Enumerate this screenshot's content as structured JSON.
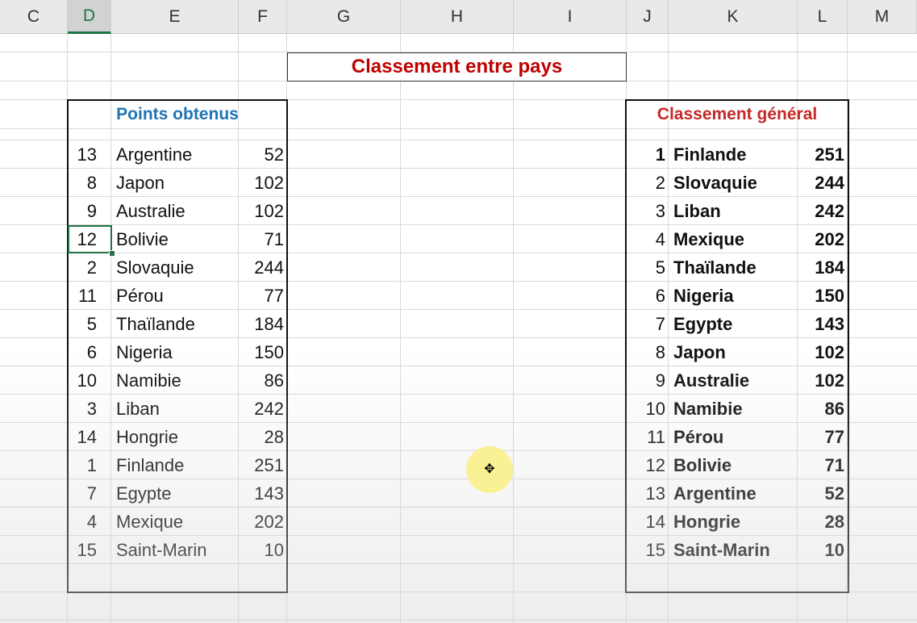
{
  "columns": [
    "C",
    "D",
    "E",
    "F",
    "G",
    "H",
    "I",
    "J",
    "K",
    "L",
    "M"
  ],
  "active_column": "D",
  "title": "Classement entre pays",
  "left_table": {
    "header": "Points obtenus",
    "rows": [
      {
        "rank": "13",
        "country": "Argentine",
        "points": "52"
      },
      {
        "rank": "8",
        "country": "Japon",
        "points": "102"
      },
      {
        "rank": "9",
        "country": "Australie",
        "points": "102"
      },
      {
        "rank": "12",
        "country": "Bolivie",
        "points": "71"
      },
      {
        "rank": "2",
        "country": "Slovaquie",
        "points": "244"
      },
      {
        "rank": "11",
        "country": "Pérou",
        "points": "77"
      },
      {
        "rank": "5",
        "country": "Thaïlande",
        "points": "184"
      },
      {
        "rank": "6",
        "country": "Nigeria",
        "points": "150"
      },
      {
        "rank": "10",
        "country": "Namibie",
        "points": "86"
      },
      {
        "rank": "3",
        "country": "Liban",
        "points": "242"
      },
      {
        "rank": "14",
        "country": "Hongrie",
        "points": "28"
      },
      {
        "rank": "1",
        "country": "Finlande",
        "points": "251"
      },
      {
        "rank": "7",
        "country": "Egypte",
        "points": "143"
      },
      {
        "rank": "4",
        "country": "Mexique",
        "points": "202"
      },
      {
        "rank": "15",
        "country": "Saint-Marin",
        "points": "10"
      }
    ]
  },
  "right_table": {
    "header": "Classement général",
    "rows": [
      {
        "rank": "1",
        "country": "Finlande",
        "points": "251"
      },
      {
        "rank": "2",
        "country": "Slovaquie",
        "points": "244"
      },
      {
        "rank": "3",
        "country": "Liban",
        "points": "242"
      },
      {
        "rank": "4",
        "country": "Mexique",
        "points": "202"
      },
      {
        "rank": "5",
        "country": "Thaïlande",
        "points": "184"
      },
      {
        "rank": "6",
        "country": "Nigeria",
        "points": "150"
      },
      {
        "rank": "7",
        "country": "Egypte",
        "points": "143"
      },
      {
        "rank": "8",
        "country": "Japon",
        "points": "102"
      },
      {
        "rank": "9",
        "country": "Australie",
        "points": "102"
      },
      {
        "rank": "10",
        "country": "Namibie",
        "points": "86"
      },
      {
        "rank": "11",
        "country": "Pérou",
        "points": "77"
      },
      {
        "rank": "12",
        "country": "Bolivie",
        "points": "71"
      },
      {
        "rank": "13",
        "country": "Argentine",
        "points": "52"
      },
      {
        "rank": "14",
        "country": "Hongrie",
        "points": "28"
      },
      {
        "rank": "15",
        "country": "Saint-Marin",
        "points": "10"
      }
    ]
  },
  "cursor": {
    "icon": "move-cursor-icon"
  },
  "colors": {
    "title": "#c00000",
    "left_header": "#1f74b5",
    "right_header": "#c62828",
    "selection": "#217346"
  }
}
